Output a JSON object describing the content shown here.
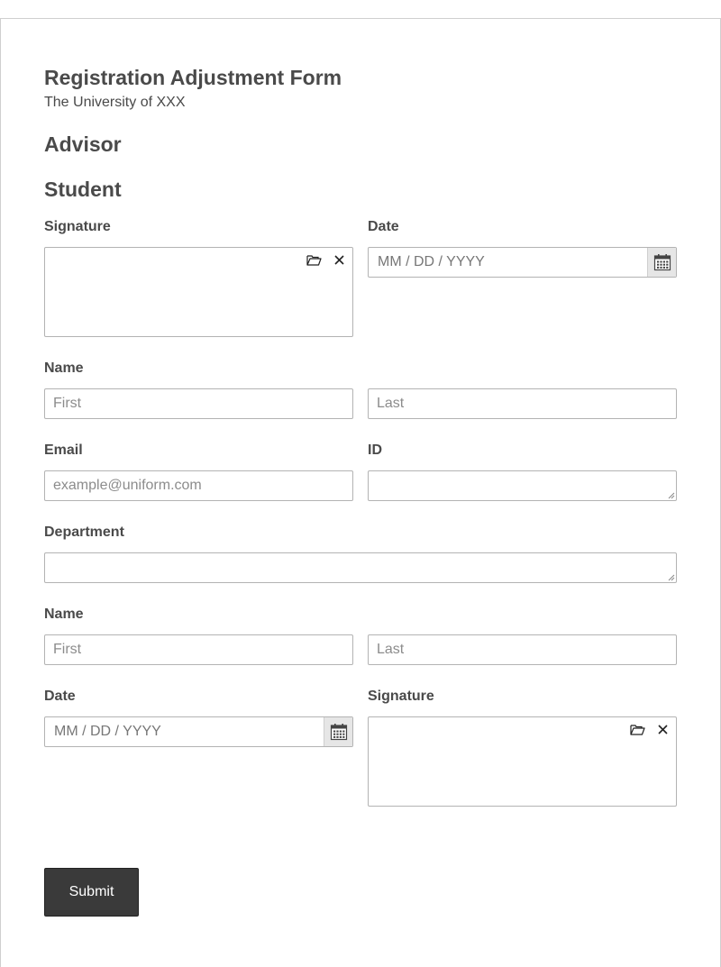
{
  "header": {
    "title": "Registration Adjustment Form",
    "subtitle": "The University of XXX"
  },
  "sections": {
    "advisor": "Advisor",
    "student": "Student"
  },
  "student": {
    "signature_label": "Signature",
    "date_label": "Date",
    "date_placeholder": "MM / DD / YYYY",
    "name_label": "Name",
    "first_placeholder": "First",
    "last_placeholder": "Last",
    "email_label": "Email",
    "email_placeholder": "example@uniform.com",
    "id_label": "ID",
    "department_label": "Department"
  },
  "second": {
    "name_label": "Name",
    "first_placeholder": "First",
    "last_placeholder": "Last",
    "date_label": "Date",
    "date_placeholder": "MM / DD / YYYY",
    "signature_label": "Signature"
  },
  "submit": {
    "label": "Submit"
  },
  "icons": {
    "upload": "folder-open-icon",
    "clear": "close-icon",
    "calendar": "calendar-icon"
  }
}
